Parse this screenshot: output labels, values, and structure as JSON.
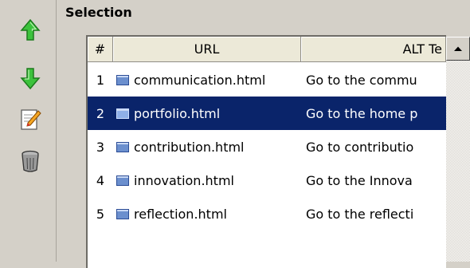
{
  "section": {
    "title": "Selection"
  },
  "toolbar": {
    "buttons": [
      {
        "icon": "arrow-up-icon",
        "color": "#2fb12f"
      },
      {
        "icon": "arrow-down-icon",
        "color": "#2fb12f"
      },
      {
        "icon": "edit-icon"
      },
      {
        "icon": "trash-icon"
      }
    ]
  },
  "table": {
    "columns": [
      "#",
      "URL",
      "ALT Te"
    ],
    "rows": [
      {
        "num": "1",
        "url": "communication.html",
        "alt": "Go to the commu"
      },
      {
        "num": "2",
        "url": "portfolio.html",
        "alt": "Go to the home p",
        "selected": true
      },
      {
        "num": "3",
        "url": "contribution.html",
        "alt": "Go to contributio"
      },
      {
        "num": "4",
        "url": "innovation.html",
        "alt": "Go to the Innova"
      },
      {
        "num": "5",
        "url": "reflection.html",
        "alt": "Go to the reflecti"
      }
    ],
    "selected_color": "#0a246a"
  }
}
